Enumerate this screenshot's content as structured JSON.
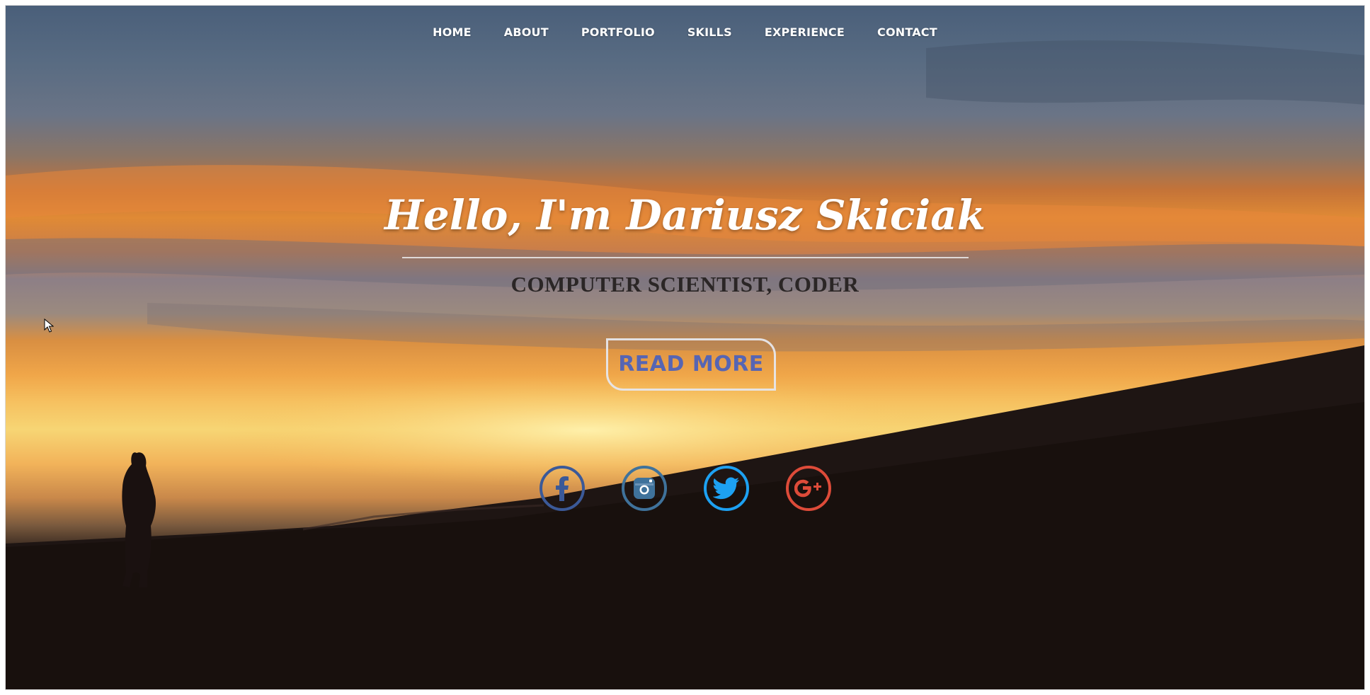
{
  "nav": {
    "items": [
      {
        "label": "HOME"
      },
      {
        "label": "ABOUT"
      },
      {
        "label": "PORTFOLIO"
      },
      {
        "label": "SKILLS"
      },
      {
        "label": "EXPERIENCE"
      },
      {
        "label": "CONTACT"
      }
    ]
  },
  "hero": {
    "title": "Hello, I'm Dariusz Skiciak",
    "subtitle": "COMPUTER SCIENTIST, CODER",
    "cta_label": "READ MORE"
  },
  "social": [
    {
      "icon": "facebook-icon",
      "color": "#3b5998"
    },
    {
      "icon": "instagram-icon",
      "color": "#3f729b"
    },
    {
      "icon": "twitter-icon",
      "color": "#1da1f2"
    },
    {
      "icon": "google-plus-icon",
      "color": "#dd4b39"
    }
  ],
  "colors": {
    "cta_text": "#5665b3",
    "subtitle_text": "#2b2626"
  }
}
